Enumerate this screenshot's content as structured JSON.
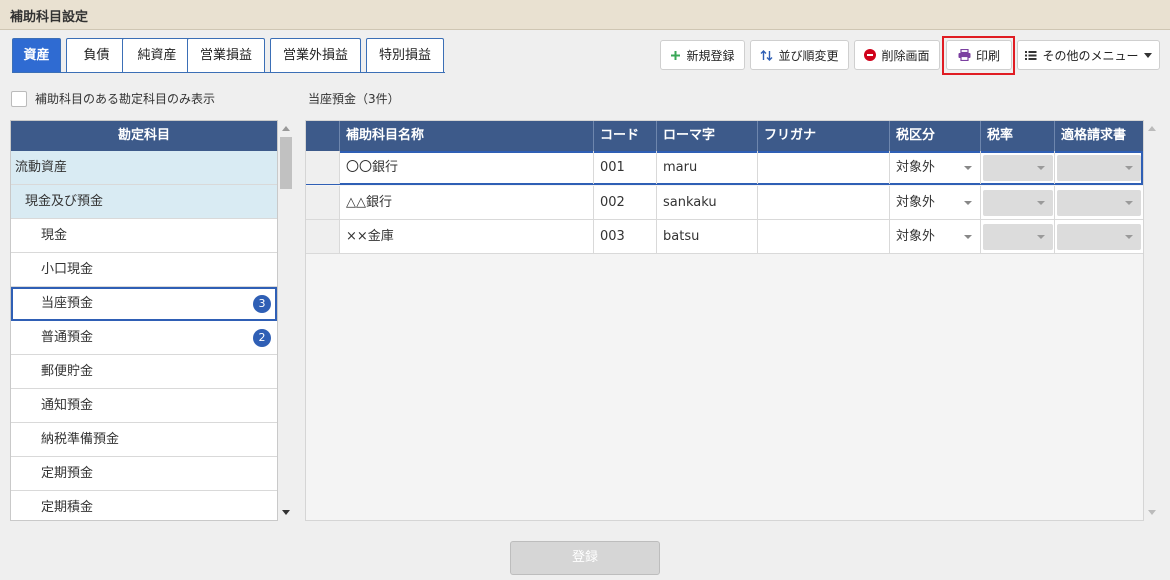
{
  "window": {
    "title": "補助科目設定"
  },
  "tabs": [
    {
      "label": "資産",
      "active": true
    },
    {
      "label": "負債"
    },
    {
      "label": "純資産"
    },
    {
      "label": "営業損益"
    },
    {
      "label": "営業外損益"
    },
    {
      "label": "特別損益"
    }
  ],
  "toolbar": {
    "new_label": "新規登録",
    "reorder_label": "並び順変更",
    "delete_label": "削除画面",
    "print_label": "印刷",
    "more_label": "その他のメニュー",
    "icons": {
      "new": "plus-icon",
      "reorder": "sort-arrows-icon",
      "delete": "minus-circle-icon",
      "print": "printer-icon",
      "more": "list-icon"
    }
  },
  "filter": {
    "label": "補助科目のある勘定科目のみ表示",
    "checked": false
  },
  "selection_label": "当座預金（3件）",
  "account_list": {
    "header": "勘定科目",
    "items": [
      {
        "label": "流動資産",
        "level": 0
      },
      {
        "label": "現金及び預金",
        "level": 1
      },
      {
        "label": "現金",
        "level": 2
      },
      {
        "label": "小口現金",
        "level": 2
      },
      {
        "label": "当座預金",
        "level": 2,
        "badge": "3",
        "selected": true
      },
      {
        "label": "普通預金",
        "level": 2,
        "badge": "2"
      },
      {
        "label": "郵便貯金",
        "level": 2
      },
      {
        "label": "通知預金",
        "level": 2
      },
      {
        "label": "納税準備預金",
        "level": 2
      },
      {
        "label": "定期預金",
        "level": 2
      },
      {
        "label": "定期積金",
        "level": 2
      }
    ]
  },
  "grid": {
    "columns": [
      "補助科目名称",
      "コード",
      "ローマ字",
      "フリガナ",
      "税区分",
      "税率",
      "適格請求書"
    ],
    "rows": [
      {
        "name": "〇〇銀行",
        "code": "001",
        "romaji": "maru",
        "furigana": "",
        "tax_category": "対象外"
      },
      {
        "name": "△△銀行",
        "code": "002",
        "romaji": "sankaku",
        "furigana": "",
        "tax_category": "対象外"
      },
      {
        "name": "××金庫",
        "code": "003",
        "romaji": "batsu",
        "furigana": "",
        "tax_category": "対象外"
      }
    ]
  },
  "footer": {
    "register_label": "登録"
  },
  "colors": {
    "accent": "#2f6bd2",
    "header_bg": "#3d5a8a",
    "highlight": "#e01c23",
    "badge": "#2f5fb5",
    "plus_green": "#3aa757",
    "delete_red": "#d0021b",
    "print_purple": "#7b3fa0"
  }
}
